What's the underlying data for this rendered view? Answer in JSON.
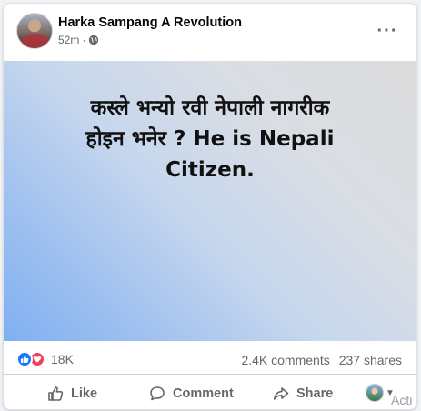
{
  "post": {
    "author": "Harka Sampang A Revolution",
    "time": "52m",
    "separator": "·",
    "privacy_icon": "globe-icon",
    "more_icon": "more-horizontal-icon",
    "more_label": "···",
    "image_text_line1": "कस्ले भन्यो रवी नेपाली नागरीक",
    "image_text_line2": "होइन भनेर ? He is Nepali",
    "image_text_line3": "Citizen."
  },
  "stats": {
    "reactions_count": "18K",
    "comments": "2.4K comments",
    "shares": "237 shares"
  },
  "actions": {
    "like_label": "Like",
    "comment_label": "Comment",
    "share_label": "Share"
  },
  "overlay": {
    "watermark": "Acti"
  },
  "colors": {
    "like_blue": "#1877f2",
    "love_red": "#f33e58",
    "secondary_text": "#65676b"
  }
}
